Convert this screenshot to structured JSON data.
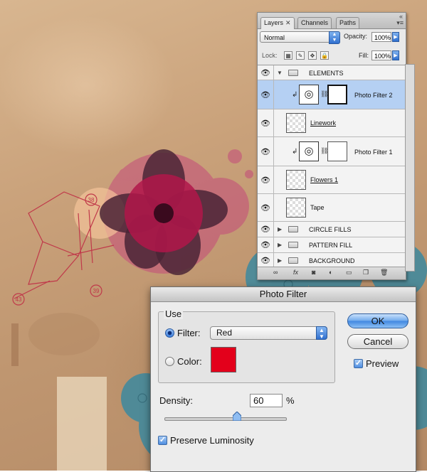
{
  "layers_panel": {
    "tabs": [
      {
        "label": "Layers",
        "active": true
      },
      {
        "label": "Channels",
        "active": false
      },
      {
        "label": "Paths",
        "active": false
      }
    ],
    "blend_mode": "Normal",
    "opacity_label": "Opacity:",
    "opacity_value": "100%",
    "lock_label": "Lock:",
    "fill_label": "Fill:",
    "fill_value": "100%",
    "layers": [
      {
        "name": "ELEMENTS",
        "type": "group",
        "expanded": true
      },
      {
        "name": "Photo Filter 2",
        "type": "adjustment",
        "selected": true
      },
      {
        "name": "Linework",
        "type": "pixel"
      },
      {
        "name": "Photo Filter 1",
        "type": "adjustment"
      },
      {
        "name": "Flowers 1",
        "type": "pixel"
      },
      {
        "name": "Tape",
        "type": "pixel"
      },
      {
        "name": "CIRCLE FILLS",
        "type": "group",
        "expanded": false
      },
      {
        "name": "PATTERN FILL",
        "type": "group",
        "expanded": false
      },
      {
        "name": "BACKGROUND",
        "type": "group",
        "expanded": false
      }
    ]
  },
  "photo_filter_dialog": {
    "title": "Photo Filter",
    "use_label": "Use",
    "filter_label": "Filter:",
    "filter_value": "Red",
    "filter_selected": true,
    "color_label": "Color:",
    "color_swatch": "#e3001b",
    "density_label": "Density:",
    "density_value": "60",
    "density_percent": 60,
    "percent_sign": "%",
    "preserve_luminosity_label": "Preserve Luminosity",
    "preserve_luminosity_checked": true,
    "ok_label": "OK",
    "cancel_label": "Cancel",
    "preview_label": "Preview",
    "preview_checked": true
  },
  "artwork": {
    "callouts": [
      "38",
      "39",
      "43"
    ]
  }
}
